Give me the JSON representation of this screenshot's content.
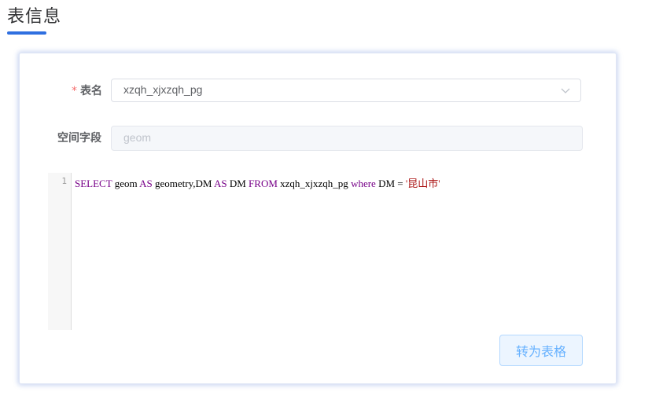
{
  "page": {
    "title": "表信息"
  },
  "form": {
    "table_name": {
      "required_mark": "*",
      "label": "表名",
      "value": "xzqh_xjxzqh_pg"
    },
    "spatial_field": {
      "label": "空间字段",
      "placeholder": "geom"
    }
  },
  "editor": {
    "line_number": "1",
    "tokens": {
      "t1": "SELECT",
      "t2": " geom ",
      "t3": "AS",
      "t4": " geometry,DM ",
      "t5": "AS",
      "t6": " DM ",
      "t7": "FROM",
      "t8": " xzqh_xjxzqh_pg ",
      "t9": "where",
      "t10": " DM = ",
      "t11": "'昆山市'"
    },
    "colors": {
      "keyword": "#770088",
      "string": "#aa1111"
    }
  },
  "actions": {
    "convert_label": "转为表格"
  },
  "icons": {
    "select_arrow": "chevron-down-icon"
  },
  "colors": {
    "accent": "#2f6fe0",
    "required": "#f56c6c",
    "button_text": "#66b1ff"
  }
}
